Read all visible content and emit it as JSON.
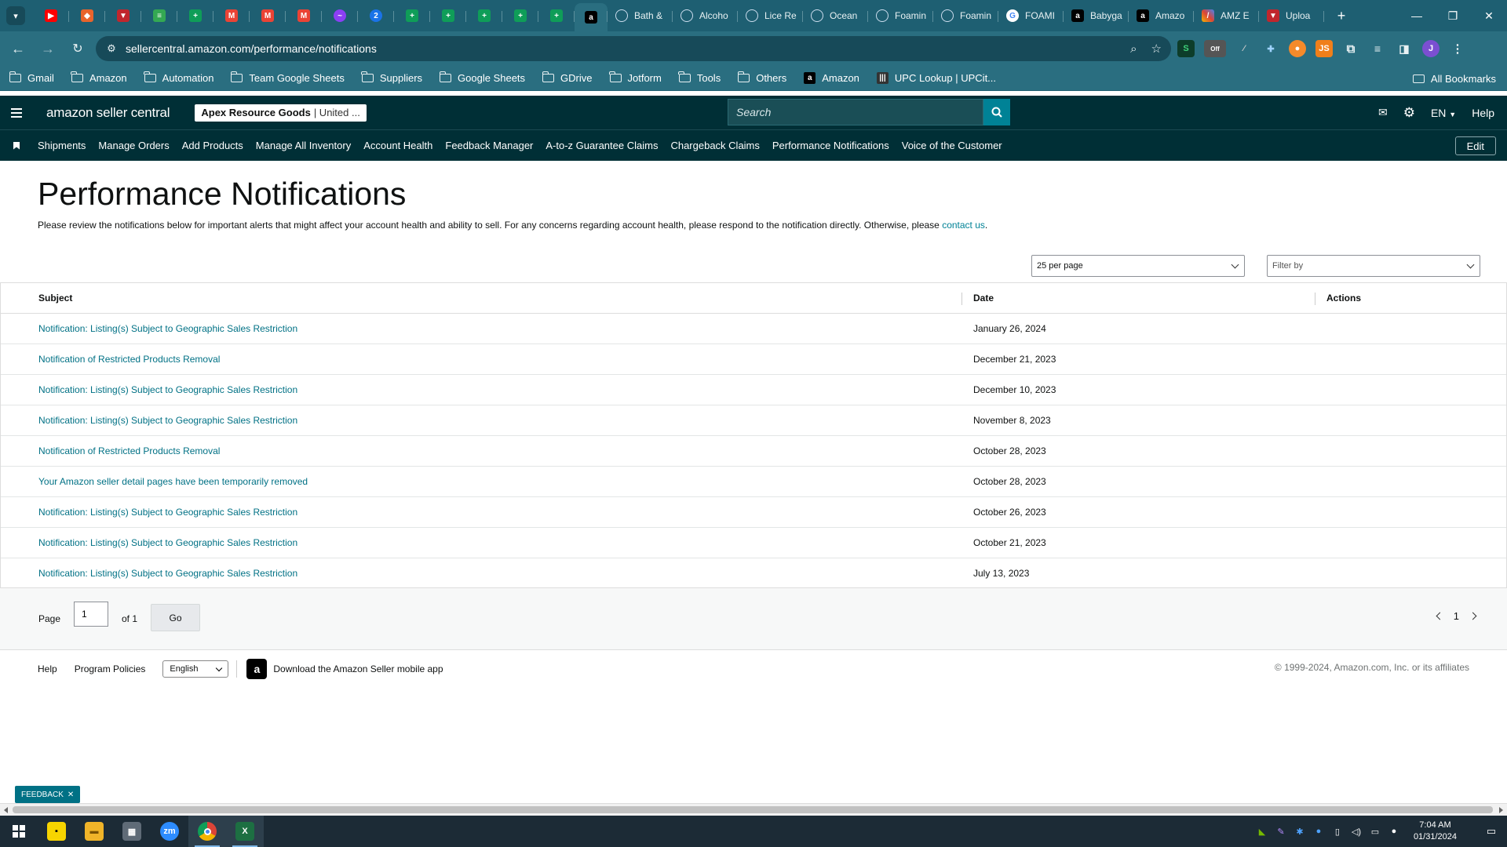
{
  "browser": {
    "tabs": [
      {
        "label": "Bath &",
        "icon": "globe-icon"
      },
      {
        "label": "Alcoho",
        "icon": "globe-icon"
      },
      {
        "label": "Lice Re",
        "icon": "globe-icon"
      },
      {
        "label": "Ocean",
        "icon": "globe-icon"
      },
      {
        "label": "Foamin",
        "icon": "globe-icon"
      },
      {
        "label": "Foamin",
        "icon": "globe-icon"
      },
      {
        "label": "FOAMI",
        "icon": "google-icon"
      },
      {
        "label": "Babyga",
        "icon": "amazon-icon"
      },
      {
        "label": "Amazo",
        "icon": "amazon-icon"
      },
      {
        "label": "AMZ E",
        "icon": "sheet-icon"
      },
      {
        "label": "Uploa",
        "icon": "shield-icon"
      }
    ],
    "url": "sellercentral.amazon.com/performance/notifications",
    "bookmarks": [
      "Gmail",
      "Amazon",
      "Automation",
      "Team Google Sheets",
      "Suppliers",
      "Google Sheets",
      "GDrive",
      "Jotform",
      "Tools",
      "Others",
      "Amazon",
      "UPC Lookup | UPCit..."
    ],
    "all_bookmarks_label": "All Bookmarks",
    "extension_badge": "Off"
  },
  "header": {
    "logo_text": "amazon seller central",
    "store_name": "Apex Resource Goods",
    "store_market": "| United ...",
    "search_placeholder": "Search",
    "language": "EN",
    "help_label": "Help"
  },
  "nav": {
    "links": [
      "Shipments",
      "Manage Orders",
      "Add Products",
      "Manage All Inventory",
      "Account Health",
      "Feedback Manager",
      "A-to-z Guarantee Claims",
      "Chargeback Claims",
      "Performance Notifications",
      "Voice of the Customer"
    ],
    "edit_label": "Edit"
  },
  "page": {
    "title": "Performance Notifications",
    "description": "Please review the notifications below for important alerts that might affect your account health and ability to sell. For any concerns regarding account health, please respond to the notification directly. Otherwise, please ",
    "contact_link": "contact us",
    "description_end": ".",
    "per_page": "25 per page",
    "filter_placeholder": "Filter by"
  },
  "table": {
    "columns": [
      "Subject",
      "Date",
      "Actions"
    ],
    "rows": [
      {
        "subject": "Notification: Listing(s) Subject to Geographic Sales Restriction",
        "date": "January 26, 2024"
      },
      {
        "subject": "Notification of Restricted Products Removal",
        "date": "December 21, 2023"
      },
      {
        "subject": "Notification: Listing(s) Subject to Geographic Sales Restriction",
        "date": "December 10, 2023"
      },
      {
        "subject": "Notification: Listing(s) Subject to Geographic Sales Restriction",
        "date": "November 8, 2023"
      },
      {
        "subject": "Notification of Restricted Products Removal",
        "date": "October 28, 2023"
      },
      {
        "subject": "Your Amazon seller detail pages have been temporarily removed",
        "date": "October 28, 2023"
      },
      {
        "subject": "Notification: Listing(s) Subject to Geographic Sales Restriction",
        "date": "October 26, 2023"
      },
      {
        "subject": "Notification: Listing(s) Subject to Geographic Sales Restriction",
        "date": "October 21, 2023"
      },
      {
        "subject": "Notification: Listing(s) Subject to Geographic Sales Restriction",
        "date": "July 13, 2023"
      }
    ]
  },
  "pager": {
    "page_label": "Page",
    "page_value": "1",
    "of_label": "of 1",
    "go_label": "Go",
    "current_page": "1"
  },
  "footer": {
    "help": "Help",
    "program_policies": "Program Policies",
    "language": "English",
    "app_text": "Download the Amazon Seller mobile app",
    "copyright": "© 1999-2024, Amazon.com, Inc. or its affiliates"
  },
  "feedback_label": "FEEDBACK",
  "taskbar": {
    "time": "7:04 AM",
    "date": "01/31/2024"
  },
  "colors": {
    "chrome_frame": "#1e5f72",
    "sc_header": "#002f36",
    "link": "#007185",
    "search_button": "#008296"
  }
}
